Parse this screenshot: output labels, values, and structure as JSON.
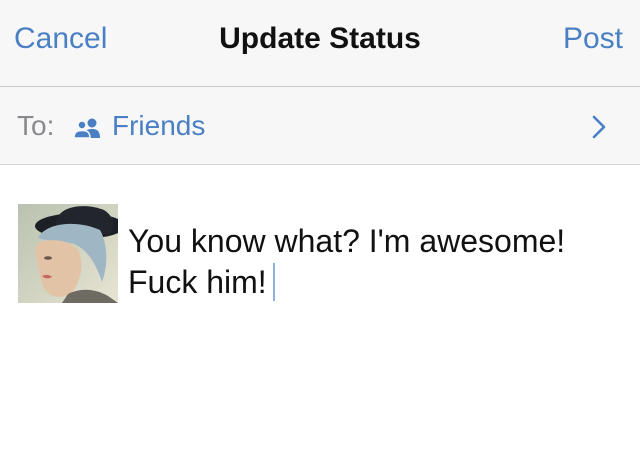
{
  "navbar": {
    "cancel_label": "Cancel",
    "title": "Update Status",
    "post_label": "Post"
  },
  "audience": {
    "to_label": "To:",
    "icon": "friends-icon",
    "value": "Friends",
    "chevron_icon": "chevron-right-icon"
  },
  "composer": {
    "avatar_icon": "profile-photo",
    "status_lines": [
      "You know what? I'm awesome!",
      "Fuck him!"
    ]
  },
  "colors": {
    "accent": "#4a7fc4",
    "bar_background": "#f7f7f8",
    "separator": "#c8c7cc",
    "secondary_text": "#8a8a8e"
  }
}
